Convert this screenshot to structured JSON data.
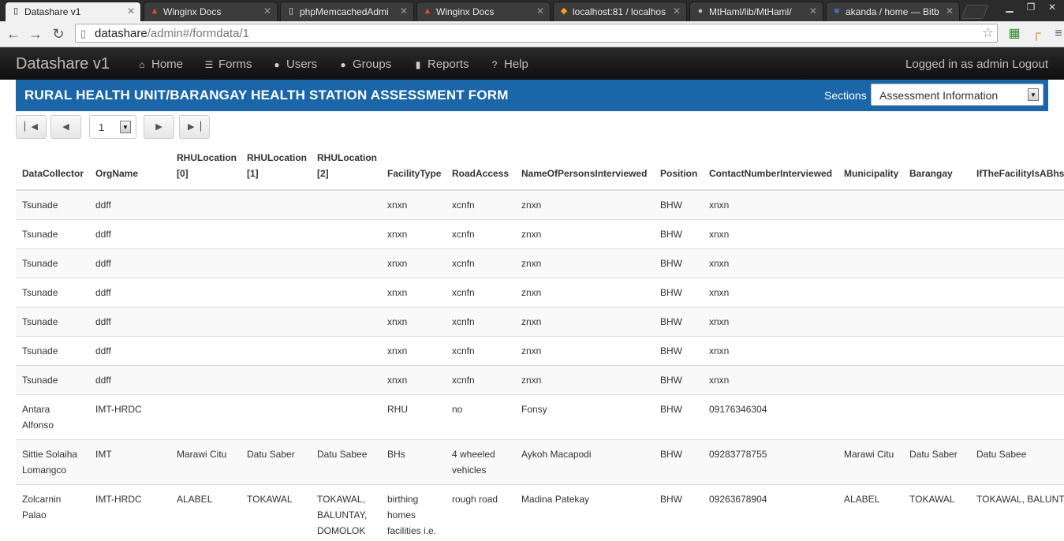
{
  "browser": {
    "tabs": [
      {
        "title": "Datashare v1",
        "icon": "page-icon"
      },
      {
        "title": "Winginx Docs",
        "icon": "winginx-icon"
      },
      {
        "title": "phpMemcachedAdmi",
        "icon": "page-icon"
      },
      {
        "title": "Winginx Docs",
        "icon": "winginx-icon"
      },
      {
        "title": "localhost:81 / localhos",
        "icon": "phpmyadmin-icon"
      },
      {
        "title": "MtHaml/lib/MtHaml/",
        "icon": "github-icon"
      },
      {
        "title": "akanda / home — Bitb",
        "icon": "bitbucket-icon"
      }
    ],
    "url_host": "datashare",
    "url_path": "/admin#/formdata/1"
  },
  "navbar": {
    "brand": "Datashare v1",
    "items": [
      {
        "label": "Home",
        "icon": "home-icon"
      },
      {
        "label": "Forms",
        "icon": "list-icon"
      },
      {
        "label": "Users",
        "icon": "user-icon"
      },
      {
        "label": "Groups",
        "icon": "user-icon"
      },
      {
        "label": "Reports",
        "icon": "signal-icon"
      },
      {
        "label": "Help",
        "icon": "question-circle-icon"
      }
    ],
    "login_status": "Logged in as admin Logout"
  },
  "form": {
    "title": "RURAL HEALTH UNIT/BARANGAY HEALTH STATION ASSESSMENT FORM",
    "sections_label": "Sections",
    "sections_selected": "Assessment Information"
  },
  "pager": {
    "page": "1"
  },
  "table": {
    "columns": [
      "DataCollector",
      "OrgName",
      "RHULocation [0]",
      "RHULocation [1]",
      "RHULocation [2]",
      "FacilityType",
      "RoadAccess",
      "NameOfPersonsInterviewed",
      "Position",
      "ContactNumberInterviewed",
      "Municipality",
      "Barangay",
      "IfTheFacilityIsABhsP"
    ],
    "rows": [
      [
        "Tsunade",
        "ddff",
        "",
        "",
        "",
        "xnxn",
        "xcnfn",
        "znxn",
        "BHW",
        "xnxn",
        "",
        "",
        ""
      ],
      [
        "Tsunade",
        "ddff",
        "",
        "",
        "",
        "xnxn",
        "xcnfn",
        "znxn",
        "BHW",
        "xnxn",
        "",
        "",
        ""
      ],
      [
        "Tsunade",
        "ddff",
        "",
        "",
        "",
        "xnxn",
        "xcnfn",
        "znxn",
        "BHW",
        "xnxn",
        "",
        "",
        ""
      ],
      [
        "Tsunade",
        "ddff",
        "",
        "",
        "",
        "xnxn",
        "xcnfn",
        "znxn",
        "BHW",
        "xnxn",
        "",
        "",
        ""
      ],
      [
        "Tsunade",
        "ddff",
        "",
        "",
        "",
        "xnxn",
        "xcnfn",
        "znxn",
        "BHW",
        "xnxn",
        "",
        "",
        ""
      ],
      [
        "Tsunade",
        "ddff",
        "",
        "",
        "",
        "xnxn",
        "xcnfn",
        "znxn",
        "BHW",
        "xnxn",
        "",
        "",
        ""
      ],
      [
        "Tsunade",
        "ddff",
        "",
        "",
        "",
        "xnxn",
        "xcnfn",
        "znxn",
        "BHW",
        "xnxn",
        "",
        "",
        ""
      ],
      [
        "Antara Alfonso",
        "IMT-HRDC",
        "",
        "",
        "",
        "RHU",
        "no",
        "Fonsy",
        "BHW",
        "09176346304",
        "",
        "",
        ""
      ],
      [
        "Sittie Solaiha Lomangco",
        "IMT",
        "Marawi Citu",
        "Datu Saber",
        "Datu Sabee",
        "BHs",
        "4 wheeled vehicles",
        "Aykoh Macapodi",
        "BHW",
        "09283778755",
        "Marawi Citu",
        "Datu Saber",
        "Datu Sabee"
      ],
      [
        "Zolcarnin Palao",
        "IMT-HRDC",
        "ALABEL",
        "TOKAWAL",
        "TOKAWAL, BALUNTAY, DOMOLOK",
        "birthing homes facilities i.e. lyi...",
        "rough road",
        "Madina Patekay",
        "BHW",
        "09263678904",
        "ALABEL",
        "TOKAWAL",
        "TOKAWAL, BALUNTAY"
      ]
    ]
  }
}
